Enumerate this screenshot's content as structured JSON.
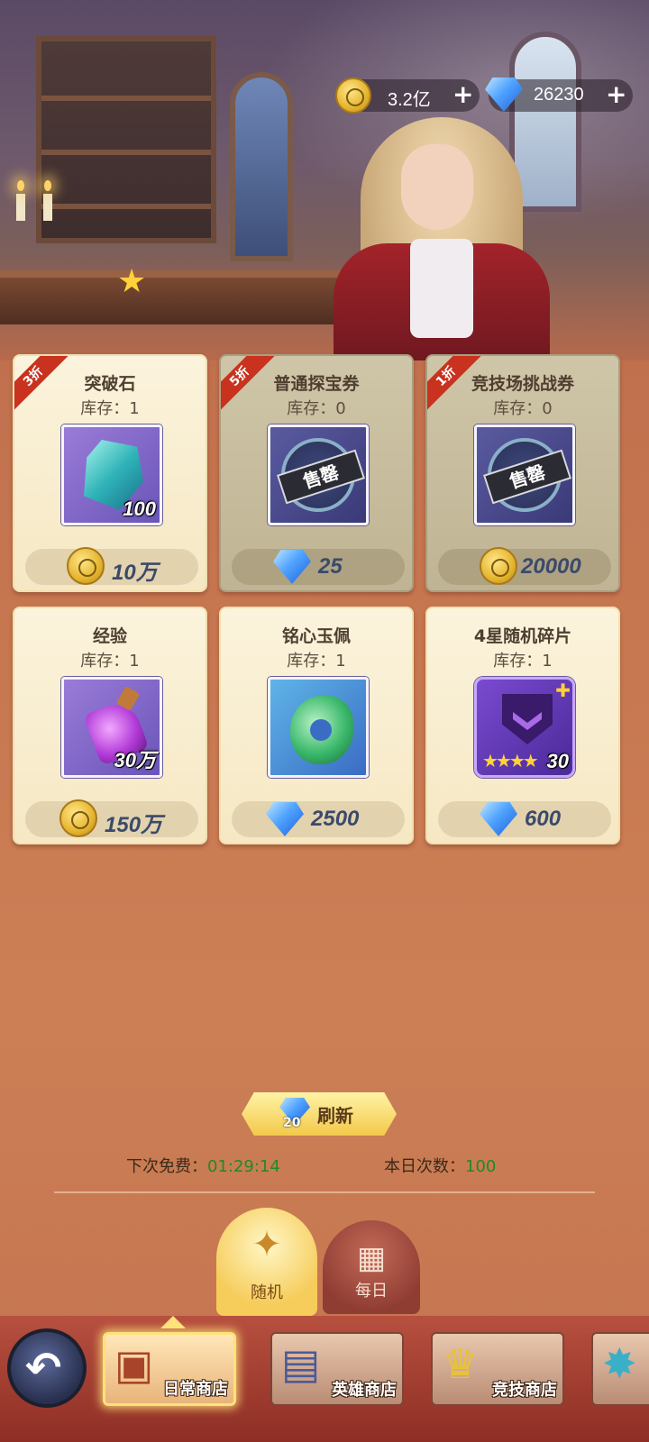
{
  "currency": {
    "gold_value": "3.2亿",
    "gem_value": "26230",
    "plus": "+"
  },
  "items": [
    {
      "discount": "3折",
      "name": "突破石",
      "stock": "库存：1",
      "qty": "100",
      "price": "10万",
      "price_type": "coin-icon",
      "sold_out": false
    },
    {
      "discount": "5折",
      "name": "普通探宝券",
      "stock": "库存：0",
      "qty": "",
      "price": "25",
      "price_type": "gem-icon",
      "sold_out": true,
      "stamp": "售罄"
    },
    {
      "discount": "1折",
      "name": "竞技场挑战券",
      "stock": "库存：0",
      "qty": "",
      "price": "20000",
      "price_type": "coin-icon",
      "sold_out": true,
      "stamp": "售罄"
    },
    {
      "discount": "",
      "name": "经验",
      "stock": "库存：1",
      "qty": "30万",
      "price": "150万",
      "price_type": "coin-icon",
      "sold_out": false
    },
    {
      "discount": "",
      "name": "铭心玉佩",
      "stock": "库存：1",
      "qty": "",
      "price": "2500",
      "price_type": "gem-icon",
      "sold_out": false
    },
    {
      "discount": "",
      "name": "4星随机碎片",
      "stock": "库存：1",
      "qty": "30",
      "price": "600",
      "price_type": "gem-icon",
      "sold_out": false
    }
  ],
  "refresh": {
    "label": "刷新",
    "cost": "20",
    "next_free_label": "下次免费：",
    "next_free_time": "01:29:14",
    "today_count_label": "本日次数：",
    "today_count": "100"
  },
  "tabs": [
    {
      "label": "随机",
      "icon": "refresh-star-icon"
    },
    {
      "label": "每日",
      "icon": "chest-icon"
    }
  ],
  "shops": [
    {
      "label": "日常商店",
      "icon": "treasure-chest-icon"
    },
    {
      "label": "英雄商店",
      "icon": "hero-card-icon"
    },
    {
      "label": "竞技商店",
      "icon": "trophy-icon"
    }
  ],
  "colors": {
    "accent_gold": "#f6cc5a",
    "discount_red": "#c8321e",
    "count_green": "#1f8a2a"
  }
}
